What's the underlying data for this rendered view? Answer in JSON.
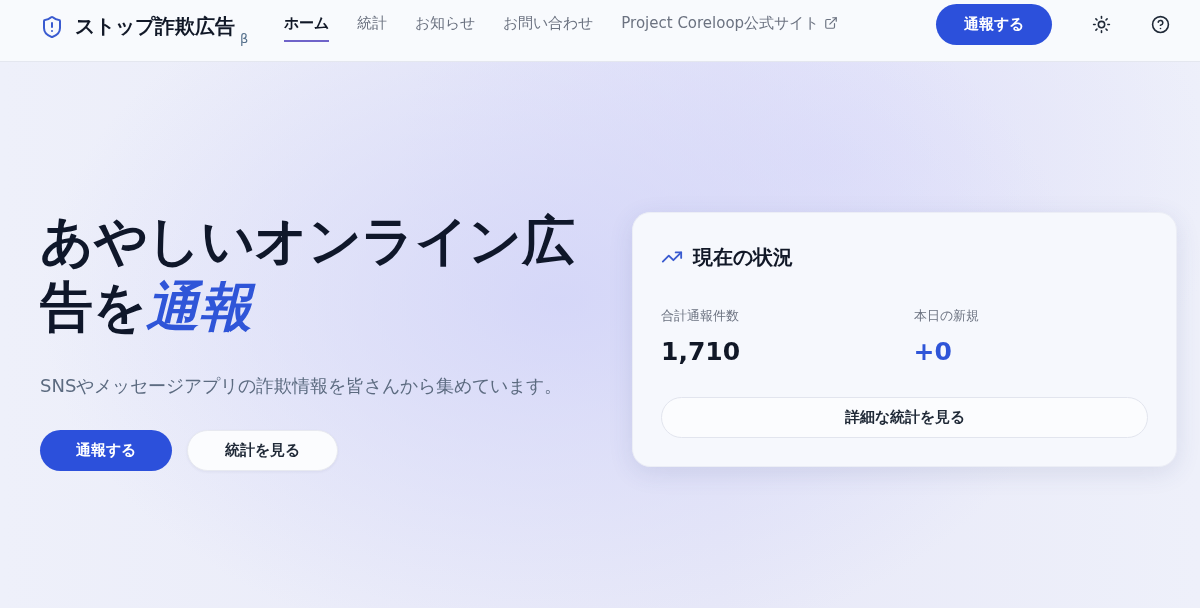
{
  "header": {
    "logo": {
      "title": "ストップ詐欺広告",
      "badge": "β"
    },
    "nav": [
      {
        "label": "ホーム",
        "selected": true,
        "kind": "internal"
      },
      {
        "label": "統計",
        "selected": false,
        "kind": "internal"
      },
      {
        "label": "お知らせ",
        "selected": false,
        "kind": "internal"
      },
      {
        "label": "お問い合わせ",
        "selected": false,
        "kind": "internal"
      },
      {
        "label": "Project Coreloop公式サイト",
        "selected": false,
        "kind": "external"
      }
    ],
    "report_button": "通報する"
  },
  "hero": {
    "headline": [
      {
        "text": "あやしいオンライン広告を",
        "kind": "plain"
      },
      {
        "text": "通報",
        "kind": "accent"
      }
    ],
    "subtitle": "SNSやメッセージアプリの詐欺情報を皆さんから集めています。",
    "buttons": [
      {
        "label": "通報する",
        "kind": "primary"
      },
      {
        "label": "統計を見る",
        "kind": "secondary"
      }
    ]
  },
  "status_card": {
    "title": "現在の状況",
    "stats": [
      {
        "label": "合計通報件数",
        "value": "1,710",
        "kind": "total"
      },
      {
        "label": "本日の新規",
        "value": "+0",
        "kind": "delta"
      }
    ],
    "button": "詳細な統計を見る"
  }
}
